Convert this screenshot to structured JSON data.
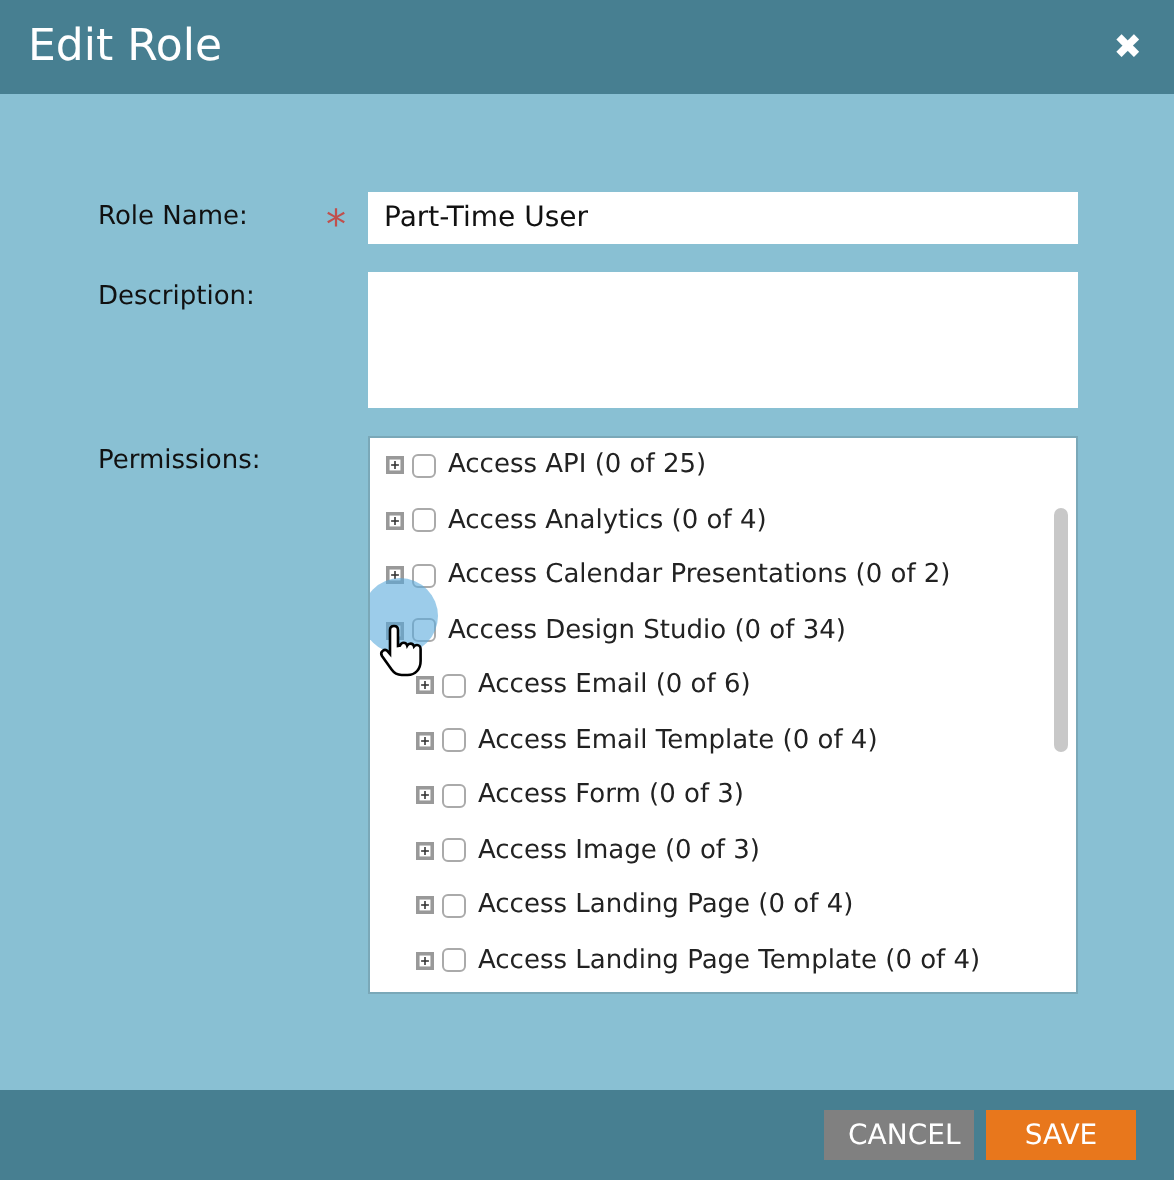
{
  "window": {
    "title": "Edit Role",
    "close": "✖"
  },
  "form": {
    "role_name": {
      "label": "Role Name:",
      "required": true,
      "required_mark": "*",
      "value": "Part-Time User"
    },
    "description": {
      "label": "Description:"
    },
    "permissions": {
      "label": "Permissions:",
      "items": [
        {
          "label": "Access API (0 of 25)",
          "expanded": false,
          "checked": false
        },
        {
          "label": "Access Analytics (0 of 4)",
          "expanded": false,
          "checked": false
        },
        {
          "label": "Access Calendar Presentations (0 of 2)",
          "expanded": false,
          "checked": false
        },
        {
          "label": "Access Design Studio (0 of 34)",
          "expanded": true,
          "checked": false,
          "hovered": true,
          "children": [
            {
              "label": "Access Email (0 of 6)",
              "expanded": false,
              "checked": false
            },
            {
              "label": "Access Email Template (0 of 4)",
              "expanded": false,
              "checked": false
            },
            {
              "label": "Access Form (0 of 3)",
              "expanded": false,
              "checked": false
            },
            {
              "label": "Access Image (0 of 3)",
              "expanded": false,
              "checked": false
            },
            {
              "label": "Access Landing Page (0 of 4)",
              "expanded": false,
              "checked": false
            },
            {
              "label": "Access Landing Page Template (0 of 4)",
              "expanded": false,
              "checked": false
            }
          ]
        }
      ]
    }
  },
  "buttons": [
    {
      "label": "CANCEL",
      "kind": "secondary"
    },
    {
      "label": "SAVE",
      "kind": "primary"
    }
  ]
}
